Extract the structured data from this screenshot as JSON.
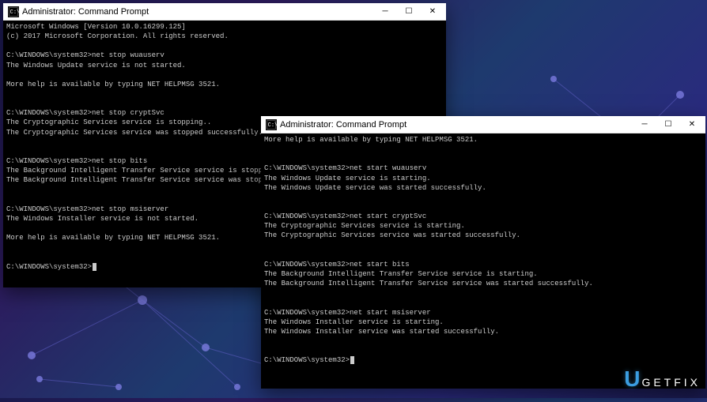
{
  "watermark": {
    "letter": "U",
    "text": "GETFIX"
  },
  "window1": {
    "title": "Administrator: Command Prompt",
    "lines": [
      "Microsoft Windows [Version 10.0.16299.125]",
      "(c) 2017 Microsoft Corporation. All rights reserved.",
      "",
      "C:\\WINDOWS\\system32>net stop wuauserv",
      "The Windows Update service is not started.",
      "",
      "More help is available by typing NET HELPMSG 3521.",
      "",
      "",
      "C:\\WINDOWS\\system32>net stop cryptSvc",
      "The Cryptographic Services service is stopping..",
      "The Cryptographic Services service was stopped successfully.",
      "",
      "",
      "C:\\WINDOWS\\system32>net stop bits",
      "The Background Intelligent Transfer Service service is stopping..",
      "The Background Intelligent Transfer Service service was stopped successfully.",
      "",
      "",
      "C:\\WINDOWS\\system32>net stop msiserver",
      "The Windows Installer service is not started.",
      "",
      "More help is available by typing NET HELPMSG 3521.",
      "",
      "",
      "C:\\WINDOWS\\system32>"
    ]
  },
  "window2": {
    "title": "Administrator: Command Prompt",
    "lines": [
      "More help is available by typing NET HELPMSG 3521.",
      "",
      "",
      "C:\\WINDOWS\\system32>net start wuauserv",
      "The Windows Update service is starting.",
      "The Windows Update service was started successfully.",
      "",
      "",
      "C:\\WINDOWS\\system32>net start cryptSvc",
      "The Cryptographic Services service is starting.",
      "The Cryptographic Services service was started successfully.",
      "",
      "",
      "C:\\WINDOWS\\system32>net start bits",
      "The Background Intelligent Transfer Service service is starting.",
      "The Background Intelligent Transfer Service service was started successfully.",
      "",
      "",
      "C:\\WINDOWS\\system32>net start msiserver",
      "The Windows Installer service is starting.",
      "The Windows Installer service was started successfully.",
      "",
      "",
      "C:\\WINDOWS\\system32>"
    ]
  }
}
